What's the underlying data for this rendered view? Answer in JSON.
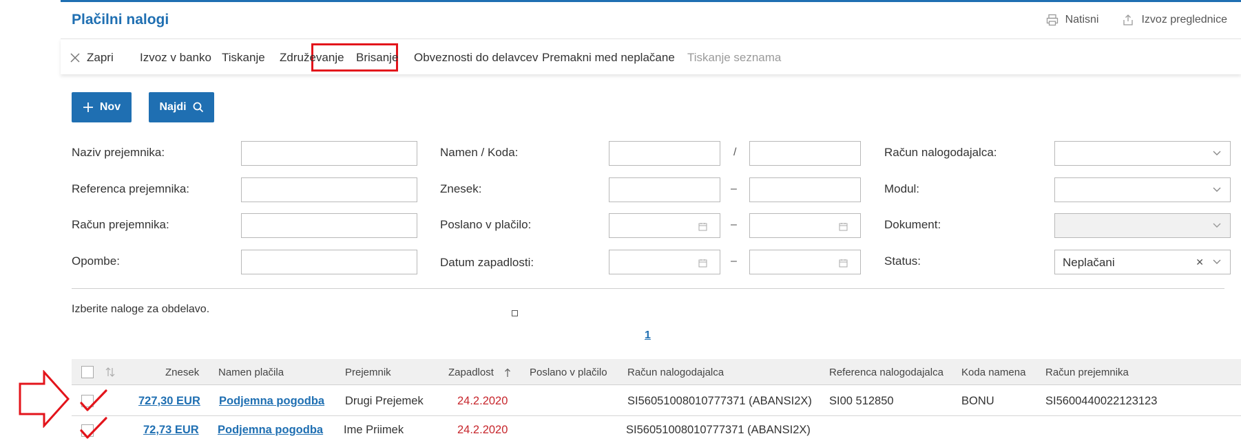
{
  "title": "Plačilni nalogi",
  "top_actions": {
    "print": "Natisni",
    "export": "Izvoz preglednice"
  },
  "menu": {
    "close": "Zapri",
    "export_bank": "Izvoz v banko",
    "print": "Tiskanje",
    "merge": "Združevanje",
    "delete": "Brisanje",
    "obligations": "Obveznosti do delavcev",
    "move_unpaid": "Premakni med neplačane",
    "print_list": "Tiskanje seznama"
  },
  "buttons": {
    "new": "Nov",
    "find": "Najdi"
  },
  "filters": {
    "recipient_name": "Naziv prejemnika:",
    "recipient_reference": "Referenca prejemnika:",
    "recipient_account": "Račun prejemnika:",
    "notes": "Opombe:",
    "purpose_code": "Namen / Koda:",
    "amount": "Znesek:",
    "sent_to_payment": "Poslano v plačilo:",
    "due_date": "Datum zapadlosti:",
    "payer_account": "Račun nalogodajalca:",
    "module": "Modul:",
    "document": "Dokument:",
    "status": "Status:",
    "status_value": "Neplačani",
    "slash": "/",
    "dash": "–"
  },
  "hint": "Izberite naloge za obdelavo.",
  "pager": "1",
  "table": {
    "headers": {
      "amount": "Znesek",
      "purpose": "Namen plačila",
      "recipient": "Prejemnik",
      "due": "Zapadlost",
      "sent": "Poslano v plačilo",
      "payer_account": "Račun nalogodajalca",
      "payer_reference": "Referenca nalogodajalca",
      "purpose_code": "Koda namena",
      "recipient_account": "Račun prejemnika"
    },
    "rows": [
      {
        "amount": "727,30 EUR",
        "purpose": "Podjemna pogodba",
        "recipient": "Drugi Prejemek",
        "due": "24.2.2020",
        "sent": "",
        "payer_account": "SI56051008010777371 (ABANSI2X)",
        "payer_reference": "SI00 512850",
        "purpose_code": "BONU",
        "recipient_account": "SI5600440022123123"
      },
      {
        "amount": "72,73 EUR",
        "purpose": "Podjemna pogodba",
        "recipient": "Ime Priimek",
        "due": "24.2.2020",
        "sent": "",
        "payer_account": "SI56051008010777371 (ABANSI2X)",
        "payer_reference": "",
        "purpose_code": "",
        "recipient_account": ""
      }
    ]
  },
  "colors": {
    "accent": "#1f6fb2",
    "highlight": "#e3141b",
    "due_red": "#c7262c"
  },
  "icons": [
    "printer-icon",
    "export-icon",
    "close-icon",
    "plus-icon",
    "search-icon",
    "chevron-down-icon",
    "calendar-icon",
    "sort-icon",
    "sort-up-icon",
    "arrow-annotation",
    "checkmark-annotation"
  ]
}
